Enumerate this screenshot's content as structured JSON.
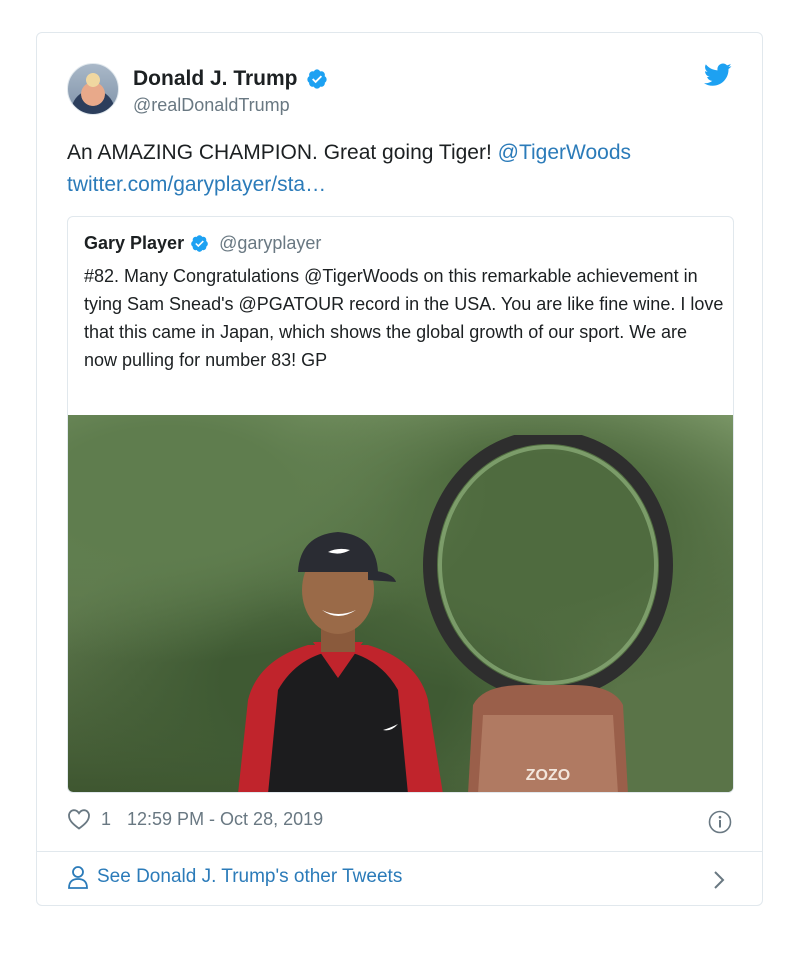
{
  "author": {
    "name": "Donald J. Trump",
    "handle": "@realDonaldTrump"
  },
  "tweet": {
    "text": "An AMAZING CHAMPION. Great going Tiger! ",
    "mention": "@TigerWoods",
    "link": "twitter.com/garyplayer/sta…"
  },
  "quote": {
    "name": "Gary Player",
    "handle": "@garyplayer",
    "text": "#82. Many Congratulations @TigerWoods on this remarkable achievement in tying Sam Snead's @PGATOUR record in the USA. You are like fine wine. I love that this came in Japan, which shows the global growth of our sport. We are now pulling for number 83! GP",
    "trophy_logo_text": "ZOZO"
  },
  "meta": {
    "likes": "1",
    "timestamp": "12:59 PM - Oct 28, 2019"
  },
  "footer": {
    "label": "See Donald J. Trump's other Tweets"
  },
  "icons": {
    "verified": "verified-badge-icon",
    "brand": "twitter-bird-icon",
    "like": "heart-icon",
    "info": "info-icon",
    "profile": "person-icon",
    "chevron": "chevron-right-icon"
  },
  "colors": {
    "link": "#2b7bb9",
    "verified": "#1da1f2",
    "text": "#1c2022",
    "secondary": "#697882",
    "border": "#e1e8ed"
  }
}
